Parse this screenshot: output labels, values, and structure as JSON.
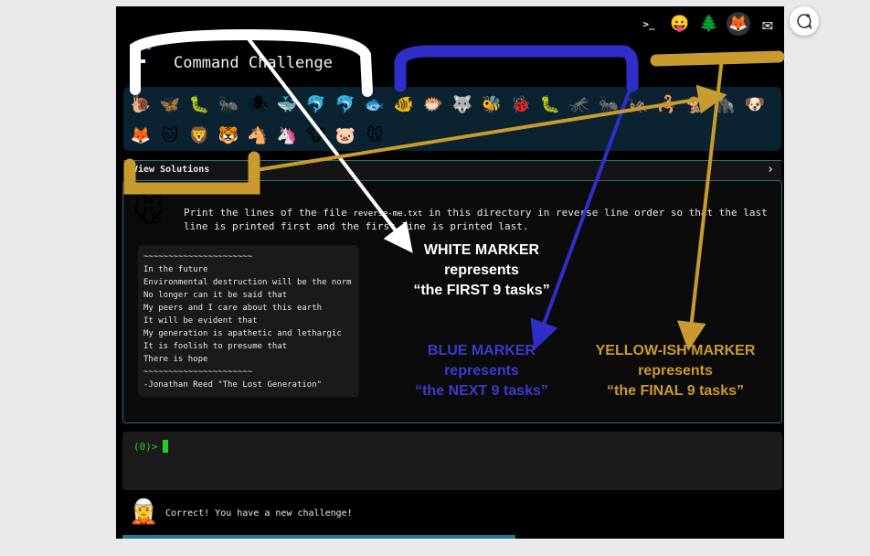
{
  "header": {
    "title": "Command Challenge",
    "top_icons": [
      {
        "name": "terminal-icon",
        "glyph": ">_"
      },
      {
        "name": "face-icon",
        "glyph": "😛"
      },
      {
        "name": "tree-icon",
        "glyph": "🌲"
      },
      {
        "name": "gitlab-icon",
        "glyph": "🦊"
      },
      {
        "name": "mail-icon",
        "glyph": "✉"
      }
    ]
  },
  "emoji_rows": [
    [
      "🐌",
      "🦋",
      "🐛",
      "🐜",
      "🕷",
      "🐳",
      "🐬",
      "🐬",
      "🐟",
      "🐠",
      "🐡",
      "🐺",
      "🐝",
      "🐞",
      "🐛",
      "🦟",
      "🐜",
      "🦗",
      "🦂",
      "🐒",
      "🦍",
      "🐶"
    ],
    [
      "🦊",
      "🐱",
      "🦁",
      "🐯",
      "🐴",
      "🦄",
      "🐮",
      "🐷",
      "🐭"
    ]
  ],
  "solutions": {
    "label": "View Solutions",
    "chevron": "›"
  },
  "challenge": {
    "avatar": "🐭",
    "desc_before": "Print the lines of the file ",
    "desc_code": "reverse-me.txt",
    "desc_after": " in this directory in reverse line order so that the last line is printed first and the first line is printed last.",
    "file_lines": [
      "~~~~~~~~~~~~~~~~~~~~~~",
      "In the future",
      "Environmental destruction will be the norm",
      "No longer can it be said that",
      "My peers and I care about this earth",
      "It will be evident that",
      "My generation is apathetic and lethargic",
      "It is foolish to presume that",
      "There is hope",
      "~~~~~~~~~~~~~~~~~~~~~~",
      "-Jonathan Reed \"The Lost Generation\""
    ]
  },
  "terminal": {
    "prompt": "(0)>"
  },
  "feedback": {
    "avatar": "🧝",
    "text": "Correct! You have a new challenge!"
  },
  "annotations": {
    "white": {
      "l1": "WHITE MARKER",
      "l2": "represents",
      "l3": "“the FIRST 9 tasks”",
      "color": "#ffffff"
    },
    "blue": {
      "l1": "BLUE MARKER",
      "l2": "represents",
      "l3": "“the NEXT 9 tasks”",
      "color": "#3a3ad0"
    },
    "yellow": {
      "l1": "YELLOW-ISH MARKER",
      "l2": "represents",
      "l3": "“the FINAL 9 tasks”",
      "color": "#c99a2e"
    }
  }
}
